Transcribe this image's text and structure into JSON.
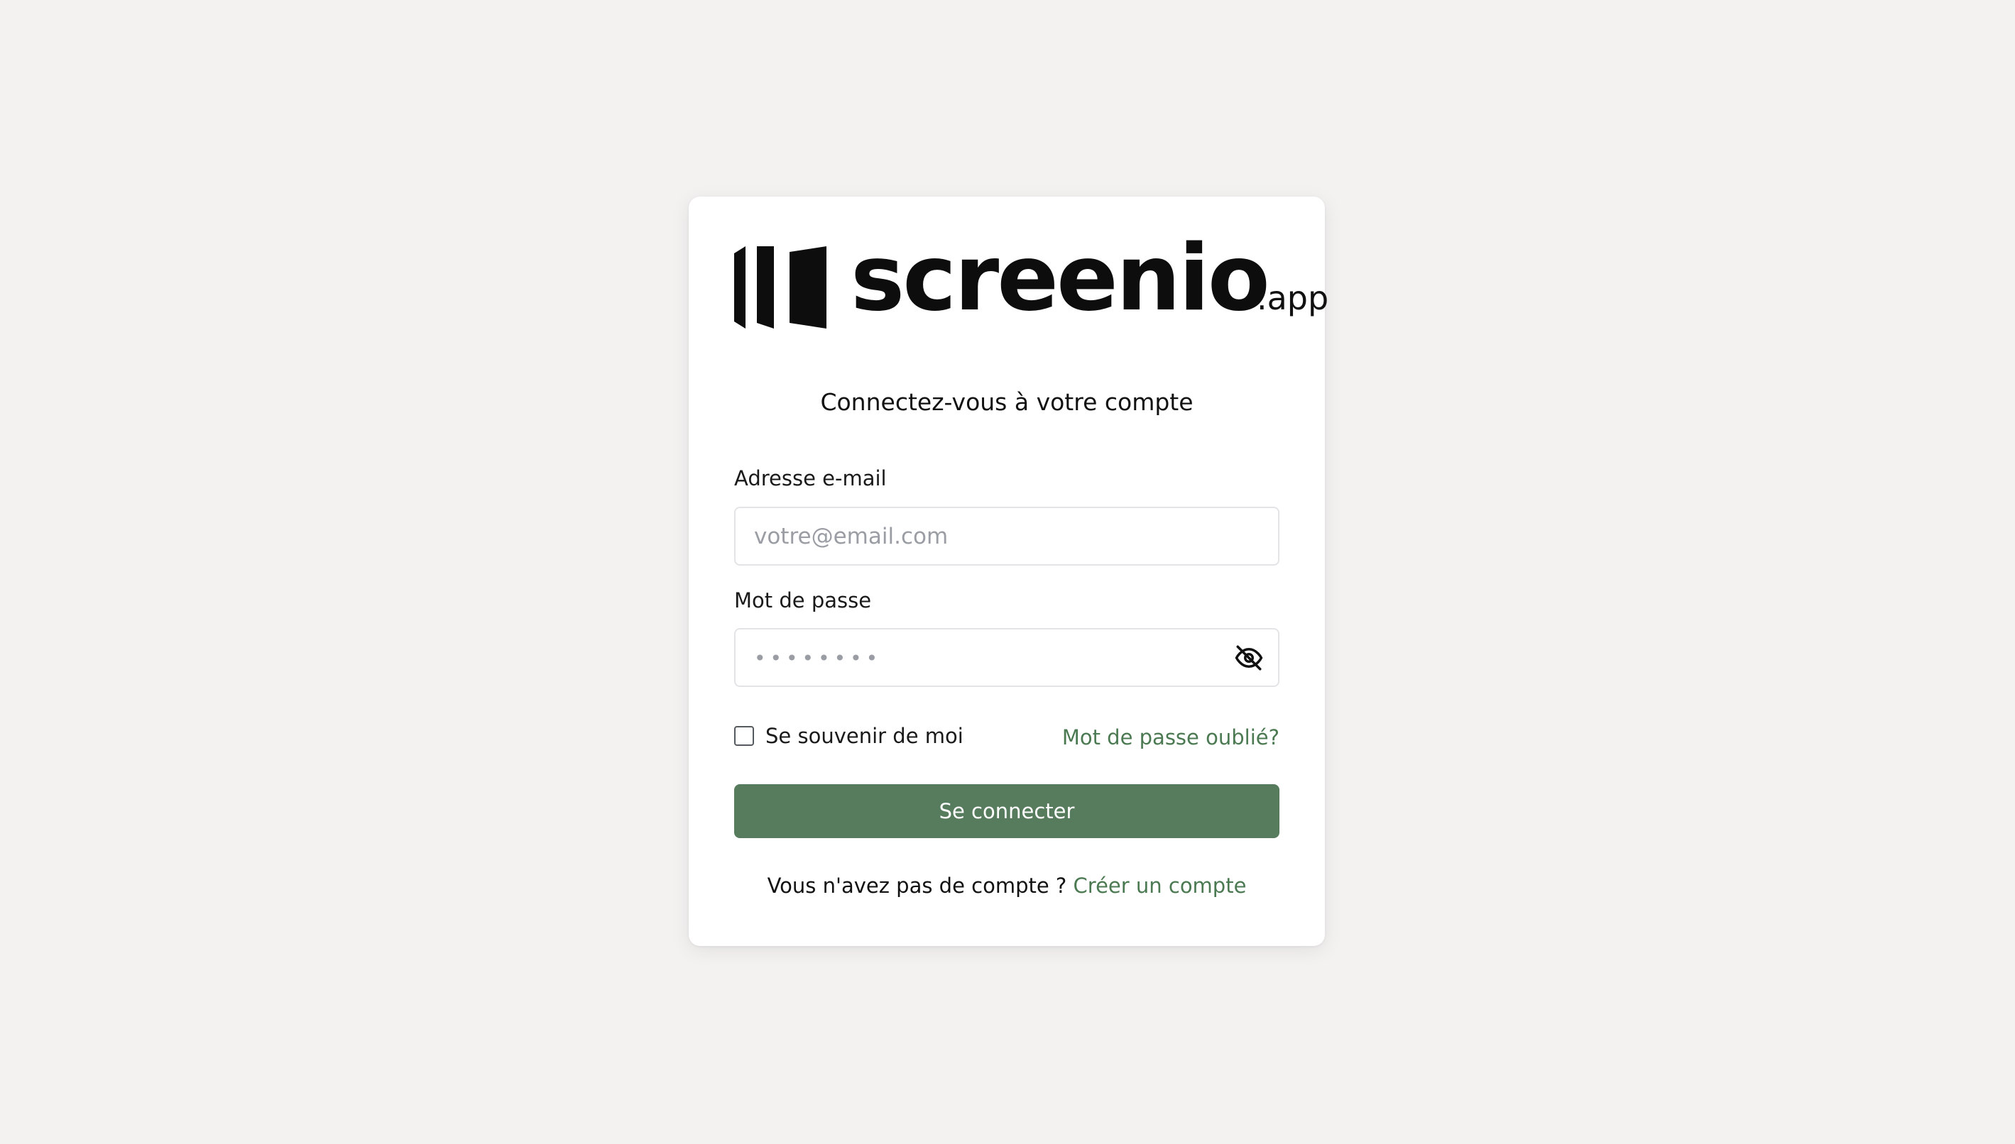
{
  "brand": {
    "name": "screenio",
    "tld": ".app",
    "accent_color": "#577c5d",
    "link_color": "#4b7a52"
  },
  "login": {
    "subtitle": "Connectez-vous à votre compte",
    "email": {
      "label": "Adresse e-mail",
      "placeholder": "votre@email.com",
      "value": ""
    },
    "password": {
      "label": "Mot de passe",
      "placeholder": "••••••••",
      "value": "",
      "toggle_icon": "eye-off-icon"
    },
    "remember": {
      "label": "Se souvenir de moi",
      "checked": false
    },
    "forgot_label": "Mot de passe oublié?",
    "submit_label": "Se connecter",
    "signup_prompt": "Vous n'avez pas de compte ?",
    "signup_link": "Créer un compte"
  }
}
